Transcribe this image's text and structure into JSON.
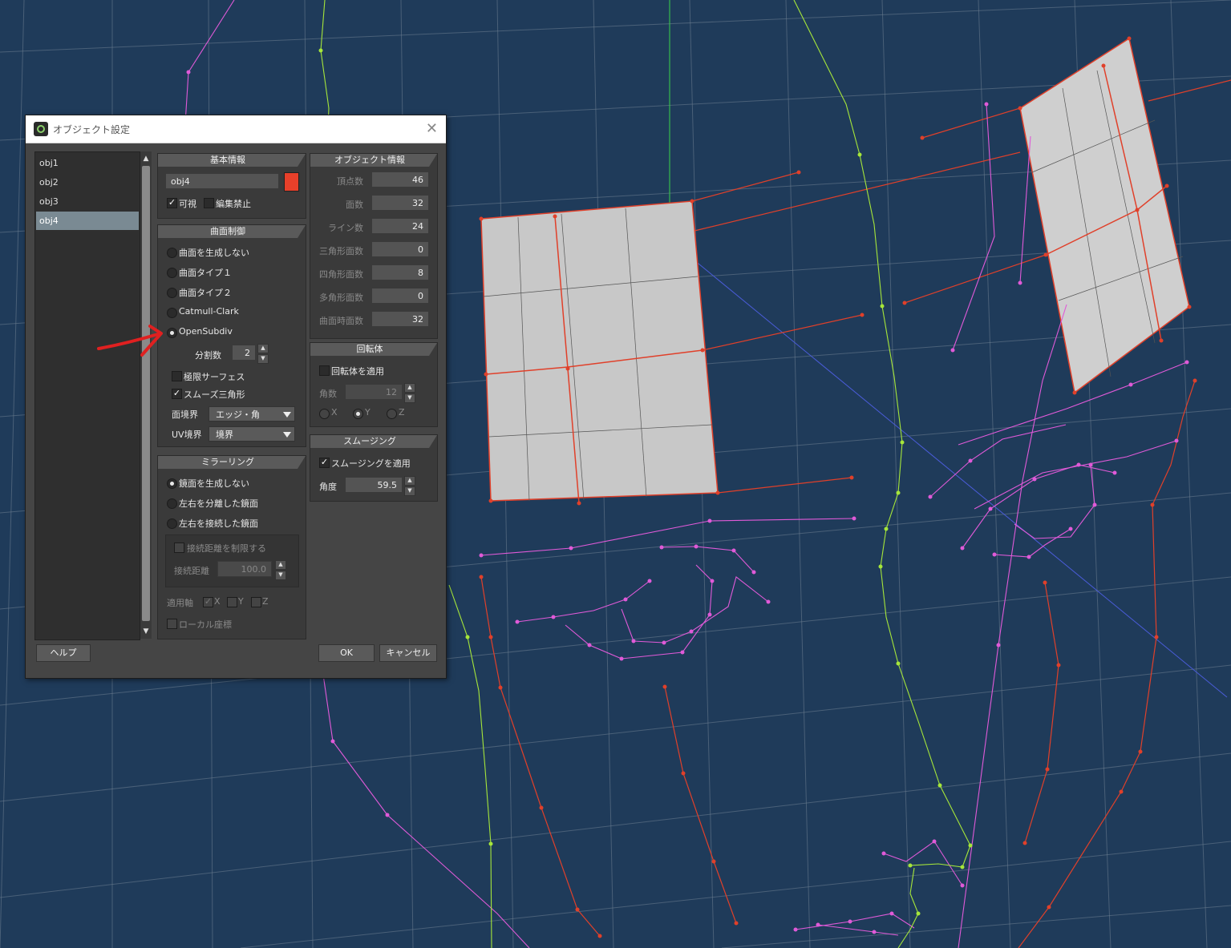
{
  "dialog": {
    "title": "オブジェクト設定",
    "close_label": "✕",
    "object_list": [
      "obj1",
      "obj2",
      "obj3",
      "obj4"
    ],
    "selected_object": "obj4",
    "basic_info": {
      "header": "基本情報",
      "name": "obj4",
      "color": "#e8402a",
      "visible_label": "可視",
      "visible_checked": true,
      "lock_label": "編集禁止",
      "lock_checked": false
    },
    "surface_control": {
      "header": "曲面制御",
      "options": [
        "曲面を生成しない",
        "曲面タイプ１",
        "曲面タイプ２",
        "Catmull-Clark",
        "OpenSubdiv"
      ],
      "selected": "OpenSubdiv",
      "subdiv_label": "分割数",
      "subdiv_value": "2",
      "limit_surface_label": "極限サーフェス",
      "smooth_tri_label": "スムーズ三角形",
      "face_boundary_label": "面境界",
      "face_boundary_value": "エッジ・角",
      "uv_boundary_label": "UV境界",
      "uv_boundary_value": "境界"
    },
    "mirroring": {
      "header": "ミラーリング",
      "options": [
        "鏡面を生成しない",
        "左右を分離した鏡面",
        "左右を接続した鏡面"
      ],
      "limit_dist_label": "接続距離を制限する",
      "dist_label": "接続距離",
      "dist_value": "100.0",
      "axis_label": "適用軸",
      "axis_x": "X",
      "axis_y": "Y",
      "axis_z": "Z",
      "local_label": "ローカル座標"
    },
    "object_info": {
      "header": "オブジェクト情報",
      "rows": [
        {
          "label": "頂点数",
          "value": "46"
        },
        {
          "label": "面数",
          "value": "32"
        },
        {
          "label": "ライン数",
          "value": "24"
        },
        {
          "label": "三角形面数",
          "value": "0"
        },
        {
          "label": "四角形面数",
          "value": "8"
        },
        {
          "label": "多角形面数",
          "value": "0"
        },
        {
          "label": "曲面時面数",
          "value": "32"
        }
      ]
    },
    "revolve": {
      "header": "回転体",
      "apply_label": "回転体を適用",
      "angle_label": "角数",
      "angle_value": "12",
      "axes": [
        "X",
        "Y",
        "Z"
      ]
    },
    "smoothing": {
      "header": "スムージング",
      "apply_label": "スムージングを適用",
      "angle_label": "角度",
      "angle_value": "59.5"
    },
    "help_button": "ヘルプ",
    "ok_button": "OK",
    "cancel_button": "キャンセル"
  },
  "colors": {
    "viewport_bg": "#1f3b5a",
    "grid": "#6d7f91",
    "face_line": "#e05ad8",
    "center_line": "#a6e63a",
    "red_line": "#e0402a",
    "annotation_arrow": "#e02020"
  }
}
